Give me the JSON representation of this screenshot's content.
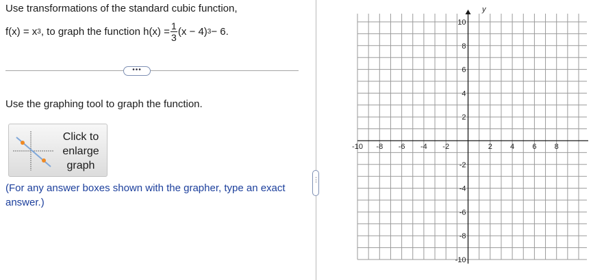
{
  "question": {
    "line1": "Use transformations of the standard cubic function,",
    "f_def": "f(x) = x",
    "f_exp": "3",
    "h_intro": ", to graph the function h(x) =",
    "frac_num": "1",
    "frac_den": "3",
    "h_body": "(x − 4)",
    "h_exp": "3",
    "h_tail": " − 6."
  },
  "more_button": {
    "label": "•••"
  },
  "instruction": "Use the graphing tool to graph the function.",
  "enlarge_button": {
    "label_lines": [
      "Click to",
      "enlarge",
      "graph"
    ],
    "icon": "graph-preview-icon"
  },
  "note": "(For any answer boxes shown with the grapher, type an exact answer.)",
  "panel_handle": {
    "label": "⋮"
  },
  "graph": {
    "axis_label_y": "y",
    "x_tick_labels": [
      "-10",
      "-8",
      "-6",
      "-4",
      "-2",
      "2",
      "4",
      "6",
      "8"
    ],
    "y_tick_labels": [
      "10",
      "8",
      "6",
      "4",
      "2",
      "-2",
      "-4",
      "-6",
      "-8",
      "-10"
    ],
    "x_range": [
      -10,
      10
    ],
    "y_range": [
      -10,
      10
    ],
    "grid_step": 1,
    "grid_color": "#9a9a9a",
    "axis_color": "#1a1a1a"
  }
}
